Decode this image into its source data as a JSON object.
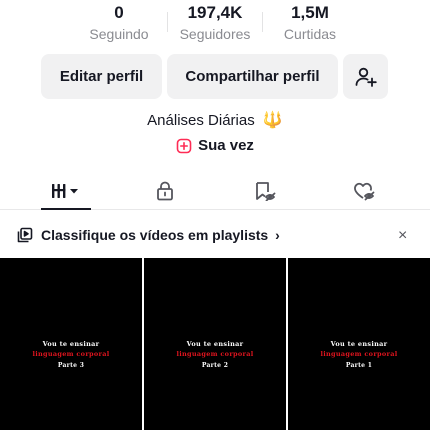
{
  "stats": [
    {
      "value": "0",
      "label": "Seguindo"
    },
    {
      "value": "197,4K",
      "label": "Seguidores"
    },
    {
      "value": "1,5M",
      "label": "Curtidas"
    }
  ],
  "actions": {
    "edit_label": "Editar perfil",
    "share_label": "Compartilhar perfil",
    "add_user_icon": "add-user-icon"
  },
  "bio": {
    "text": "Análises Diárias",
    "emoji": "🔱"
  },
  "your_turn": {
    "label": "Sua vez",
    "icon": "plus-square-icon",
    "accent": "#fe2c55"
  },
  "tabs": [
    {
      "icon": "grid-icon",
      "active": true
    },
    {
      "icon": "lock-icon",
      "active": false
    },
    {
      "icon": "hidden-bookmark-icon",
      "active": false
    },
    {
      "icon": "hidden-heart-icon",
      "active": false
    }
  ],
  "playlist_banner": {
    "text": "Classifique os vídeos em playlists",
    "chevron": "›",
    "close": "×"
  },
  "videos": [
    {
      "line1": "Vou te ensinar",
      "line2": "linguagem corporal",
      "line3": "Parte 3"
    },
    {
      "line1": "Vou te ensinar",
      "line2": "linguagem corporal",
      "line3": "Parte 2"
    },
    {
      "line1": "Vou te ensinar",
      "line2": "linguagem corporal",
      "line3": "Parte 1"
    }
  ]
}
